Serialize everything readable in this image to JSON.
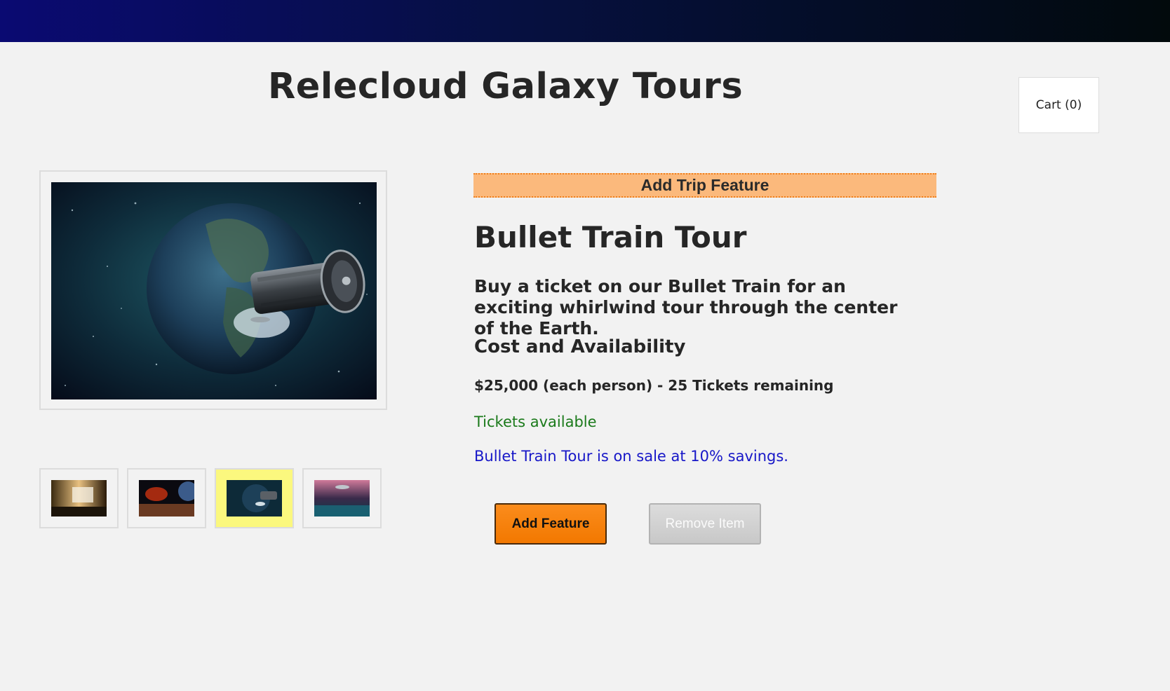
{
  "header": {
    "site_title": "Relecloud Galaxy Tours",
    "cart_label": "Cart (0)"
  },
  "gallery": {
    "main_image": "space-train-earth-image",
    "thumbnails": [
      {
        "image": "train-interior-thumbnail",
        "selected": false
      },
      {
        "image": "planet-surface-thumbnail",
        "selected": false
      },
      {
        "image": "space-train-earth-thumbnail",
        "selected": true
      },
      {
        "image": "alien-landscape-thumbnail",
        "selected": false
      }
    ],
    "selected_color": "#fbf87e"
  },
  "product": {
    "banner": "Add Trip Feature",
    "title": "Bullet Train Tour",
    "description": "Buy a ticket on our Bullet Train for an exciting whirlwind tour through the center of the Earth.",
    "cost_heading": "Cost and Availability",
    "price_line": "$25,000 (each person) - 25 Tickets remaining",
    "availability": "Tickets available",
    "sale_message": "Bullet Train Tour is on sale at 10% savings."
  },
  "actions": {
    "add_label": "Add Feature",
    "remove_label": "Remove Item",
    "remove_disabled": true
  },
  "colors": {
    "accent_orange": "#f27800",
    "banner_bg": "#fbb97c",
    "available_green": "#1b7a1b",
    "sale_blue": "#1717c8"
  }
}
